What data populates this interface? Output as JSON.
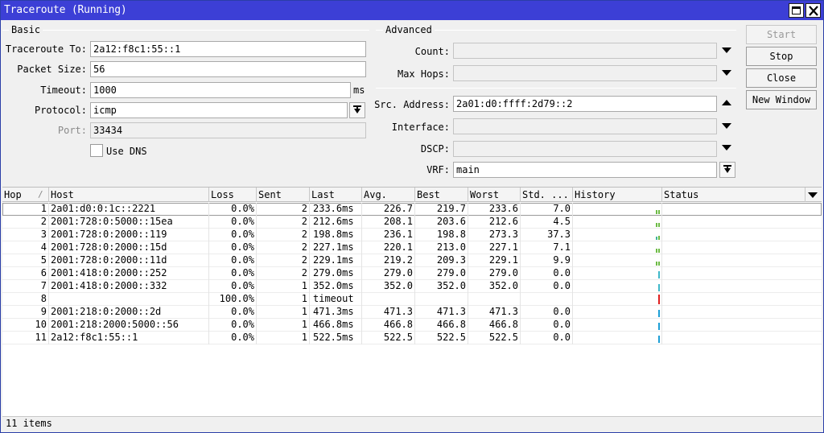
{
  "window": {
    "title": "Traceroute (Running)"
  },
  "basic": {
    "group_label": "Basic",
    "traceroute_to_label": "Traceroute To:",
    "traceroute_to_value": "2a12:f8c1:55::1",
    "packet_size_label": "Packet Size:",
    "packet_size_value": "56",
    "timeout_label": "Timeout:",
    "timeout_value": "1000",
    "timeout_unit": "ms",
    "protocol_label": "Protocol:",
    "protocol_value": "icmp",
    "port_label": "Port:",
    "port_value": "33434",
    "use_dns_label": "Use DNS",
    "use_dns_checked": false
  },
  "advanced": {
    "group_label": "Advanced",
    "count_label": "Count:",
    "count_value": "",
    "max_hops_label": "Max Hops:",
    "max_hops_value": "",
    "src_address_label": "Src. Address:",
    "src_address_value": "2a01:d0:ffff:2d79::2",
    "interface_label": "Interface:",
    "interface_value": "",
    "dscp_label": "DSCP:",
    "dscp_value": "",
    "vrf_label": "VRF:",
    "vrf_value": "main"
  },
  "buttons": {
    "start": "Start",
    "stop": "Stop",
    "close": "Close",
    "new_window": "New Window"
  },
  "table": {
    "columns": [
      "Hop",
      "Host",
      "Loss",
      "Sent",
      "Last",
      "Avg.",
      "Best",
      "Worst",
      "Std. ...",
      "History",
      "Status"
    ],
    "sort_indicator": "/",
    "rows": [
      {
        "hop": "1",
        "host": "2a01:d0:0:1c::2221",
        "loss": "0.0%",
        "sent": "2",
        "last": "233.6ms",
        "avg": "226.7",
        "best": "219.7",
        "worst": "233.6",
        "std": "7.0",
        "history": [
          "#6dbb45",
          "#6dbb45"
        ]
      },
      {
        "hop": "2",
        "host": "2001:728:0:5000::15ea",
        "loss": "0.0%",
        "sent": "2",
        "last": "212.6ms",
        "avg": "208.1",
        "best": "203.6",
        "worst": "212.6",
        "std": "4.5",
        "history": [
          "#6dbb45",
          "#6dbb45"
        ]
      },
      {
        "hop": "3",
        "host": "2001:728:0:2000::119",
        "loss": "0.0%",
        "sent": "2",
        "last": "198.8ms",
        "avg": "236.1",
        "best": "198.8",
        "worst": "273.3",
        "std": "37.3",
        "history": [
          "#3fb59a",
          "#6dbb45"
        ]
      },
      {
        "hop": "4",
        "host": "2001:728:0:2000::15d",
        "loss": "0.0%",
        "sent": "2",
        "last": "227.1ms",
        "avg": "220.1",
        "best": "213.0",
        "worst": "227.1",
        "std": "7.1",
        "history": [
          "#6dbb45",
          "#6dbb45"
        ]
      },
      {
        "hop": "5",
        "host": "2001:728:0:2000::11d",
        "loss": "0.0%",
        "sent": "2",
        "last": "229.1ms",
        "avg": "219.2",
        "best": "209.3",
        "worst": "229.1",
        "std": "9.9",
        "history": [
          "#6dbb45",
          "#6dbb45"
        ]
      },
      {
        "hop": "6",
        "host": "2001:418:0:2000::252",
        "loss": "0.0%",
        "sent": "2",
        "last": "279.0ms",
        "avg": "279.0",
        "best": "279.0",
        "worst": "279.0",
        "std": "0.0",
        "history": [
          "#3fb8c9"
        ]
      },
      {
        "hop": "7",
        "host": "2001:418:0:2000::332",
        "loss": "0.0%",
        "sent": "1",
        "last": "352.0ms",
        "avg": "352.0",
        "best": "352.0",
        "worst": "352.0",
        "std": "0.0",
        "history": [
          "#3fb8c9"
        ]
      },
      {
        "hop": "8",
        "host": "",
        "loss": "100.0%",
        "sent": "1",
        "last": "timeout",
        "avg": "",
        "best": "",
        "worst": "",
        "std": "",
        "history": [
          "#e02020"
        ]
      },
      {
        "hop": "9",
        "host": "2001:218:0:2000::2d",
        "loss": "0.0%",
        "sent": "1",
        "last": "471.3ms",
        "avg": "471.3",
        "best": "471.3",
        "worst": "471.3",
        "std": "0.0",
        "history": [
          "#1e9fd6"
        ]
      },
      {
        "hop": "10",
        "host": "2001:218:2000:5000::56",
        "loss": "0.0%",
        "sent": "1",
        "last": "466.8ms",
        "avg": "466.8",
        "best": "466.8",
        "worst": "466.8",
        "std": "0.0",
        "history": [
          "#1e9fd6"
        ]
      },
      {
        "hop": "11",
        "host": "2a12:f8c1:55::1",
        "loss": "0.0%",
        "sent": "1",
        "last": "522.5ms",
        "avg": "522.5",
        "best": "522.5",
        "worst": "522.5",
        "std": "0.0",
        "history": [
          "#1e9fd6"
        ]
      }
    ]
  },
  "status_bar": {
    "text": "11 items"
  },
  "icons": [
    "maximize-icon",
    "close-icon",
    "dropdown-arrow-icon",
    "dropdown-up-arrow-icon",
    "down-arrow-box-icon",
    "column-menu-icon"
  ],
  "colors": {
    "titlebar": "#3c3fd6",
    "history_green": "#6dbb45",
    "history_timeout": "#e02020",
    "history_blue": "#1e9fd6"
  }
}
